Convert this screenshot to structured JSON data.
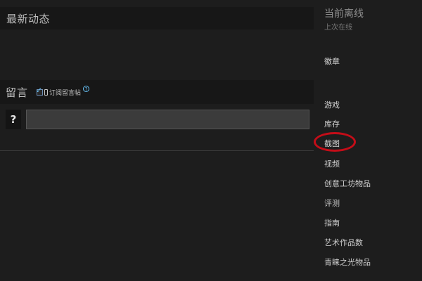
{
  "activity": {
    "title": "最新动态"
  },
  "comments": {
    "title": "留言",
    "subscribe_label": "订阅留言帖",
    "help_badge": "?",
    "avatar_glyph": "?",
    "input_value": ""
  },
  "sidebar": {
    "status_title": "当前离线",
    "status_sub": "上次在线",
    "links": [
      {
        "label": "徽章"
      },
      {
        "label": "游戏"
      },
      {
        "label": "库存"
      },
      {
        "label": "截图",
        "highlighted": true
      },
      {
        "label": "视频"
      },
      {
        "label": "创意工坊物品"
      },
      {
        "label": "评测"
      },
      {
        "label": "指南"
      },
      {
        "label": "艺术作品数"
      },
      {
        "label": "青睐之光物品"
      }
    ]
  },
  "colors": {
    "background": "#1d1d1d",
    "bar": "#171717",
    "highlight_ring": "#c40d18",
    "accent": "#66c0f4"
  }
}
